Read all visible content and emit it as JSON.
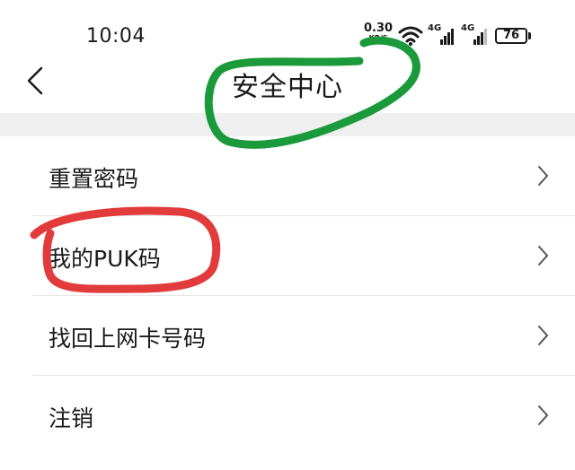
{
  "status_bar": {
    "time": "10:04",
    "net_speed": "0.30",
    "net_speed_unit": "KB/S",
    "sim1_type": "4G",
    "sim2_type": "4G",
    "battery": "76",
    "icons": [
      "wifi-icon",
      "signal-icon",
      "battery-icon"
    ]
  },
  "header": {
    "back_icon": "chevron-left-icon",
    "title": "安全中心"
  },
  "menu": {
    "items": [
      {
        "label": "重置密码"
      },
      {
        "label": "我的PUK码"
      },
      {
        "label": "找回上网卡号码"
      },
      {
        "label": "注销"
      }
    ],
    "chevron_icon": "chevron-right-icon"
  },
  "annotations": {
    "green_circle_color": "#1a9a3a",
    "red_circle_color": "#e23b3b"
  }
}
